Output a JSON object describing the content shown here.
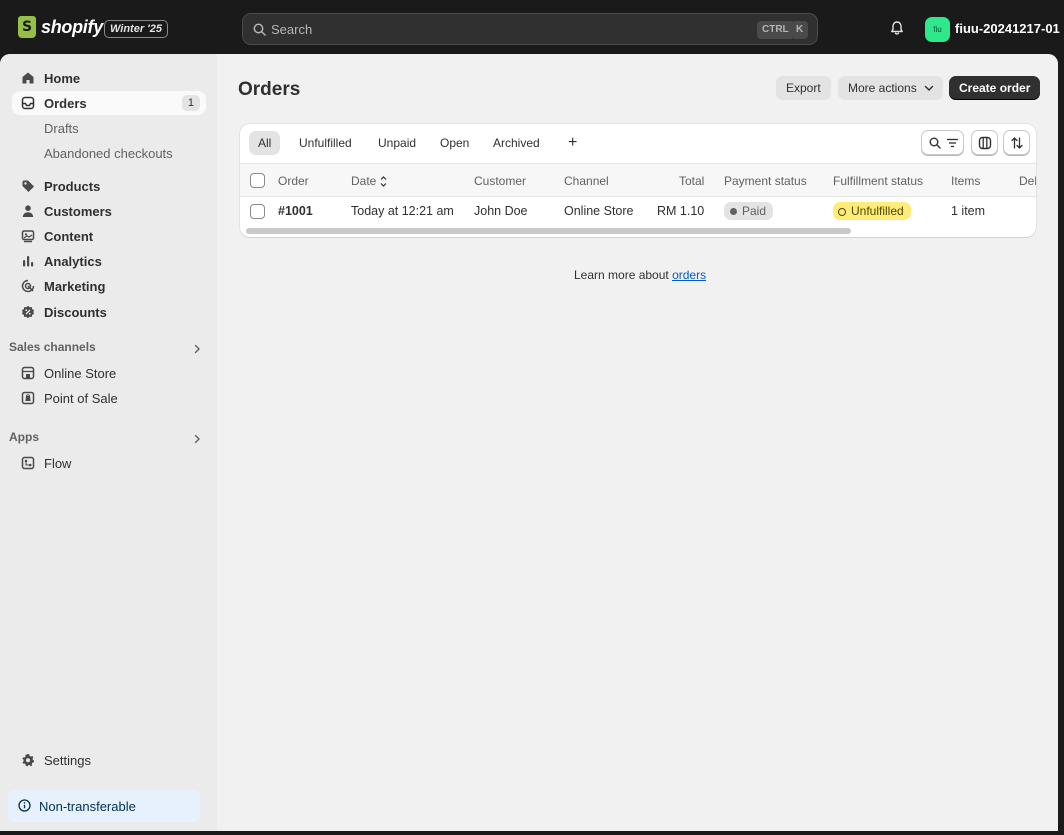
{
  "topbar": {
    "logo_text": "shopify",
    "release_badge": "Winter '25",
    "search_placeholder": "Search",
    "shortcut_ctrl": "CTRL",
    "shortcut_k": "K",
    "avatar_initials": "fiu",
    "store_name": "fiuu-20241217-01"
  },
  "sidebar": {
    "items": [
      {
        "label": "Home",
        "icon": "home-icon"
      },
      {
        "label": "Orders",
        "icon": "orders-icon",
        "count": "1"
      },
      {
        "label": "Drafts"
      },
      {
        "label": "Abandoned checkouts"
      },
      {
        "label": "Products",
        "icon": "tag-icon"
      },
      {
        "label": "Customers",
        "icon": "person-icon"
      },
      {
        "label": "Content",
        "icon": "content-icon"
      },
      {
        "label": "Analytics",
        "icon": "bar-chart-icon"
      },
      {
        "label": "Marketing",
        "icon": "target-icon"
      },
      {
        "label": "Discounts",
        "icon": "discount-icon"
      }
    ],
    "sales_channels_heading": "Sales channels",
    "sales_channels": [
      {
        "label": "Online Store",
        "icon": "store-icon"
      },
      {
        "label": "Point of Sale",
        "icon": "pos-icon"
      }
    ],
    "apps_heading": "Apps",
    "apps": [
      {
        "label": "Flow",
        "icon": "flow-icon"
      }
    ],
    "settings_label": "Settings",
    "nontransferable_label": "Non-transferable"
  },
  "main": {
    "title": "Orders",
    "export_label": "Export",
    "more_actions_label": "More actions",
    "create_order_label": "Create order",
    "tabs": [
      "All",
      "Unfulfilled",
      "Unpaid",
      "Open",
      "Archived"
    ],
    "add_tab_label": "+",
    "columns": [
      "Order",
      "Date",
      "Customer",
      "Channel",
      "Total",
      "Payment status",
      "Fulfillment status",
      "Items",
      "Del"
    ],
    "rows": [
      {
        "order": "#1001",
        "date": "Today at 12:21 am",
        "customer": "John Doe",
        "channel": "Online Store",
        "total": "RM 1.10",
        "payment_status": "Paid",
        "fulfillment_status": "Unfulfilled",
        "items": "1 item"
      }
    ],
    "learn_more_prefix": "Learn more about ",
    "learn_more_link": "orders"
  },
  "colors": {
    "topbar_bg": "#1a1a1a",
    "primary_button": "#303030",
    "unfulfilled_badge": "#ffeb78",
    "avatar_bg": "#2ee88a",
    "link": "#005bd3"
  }
}
